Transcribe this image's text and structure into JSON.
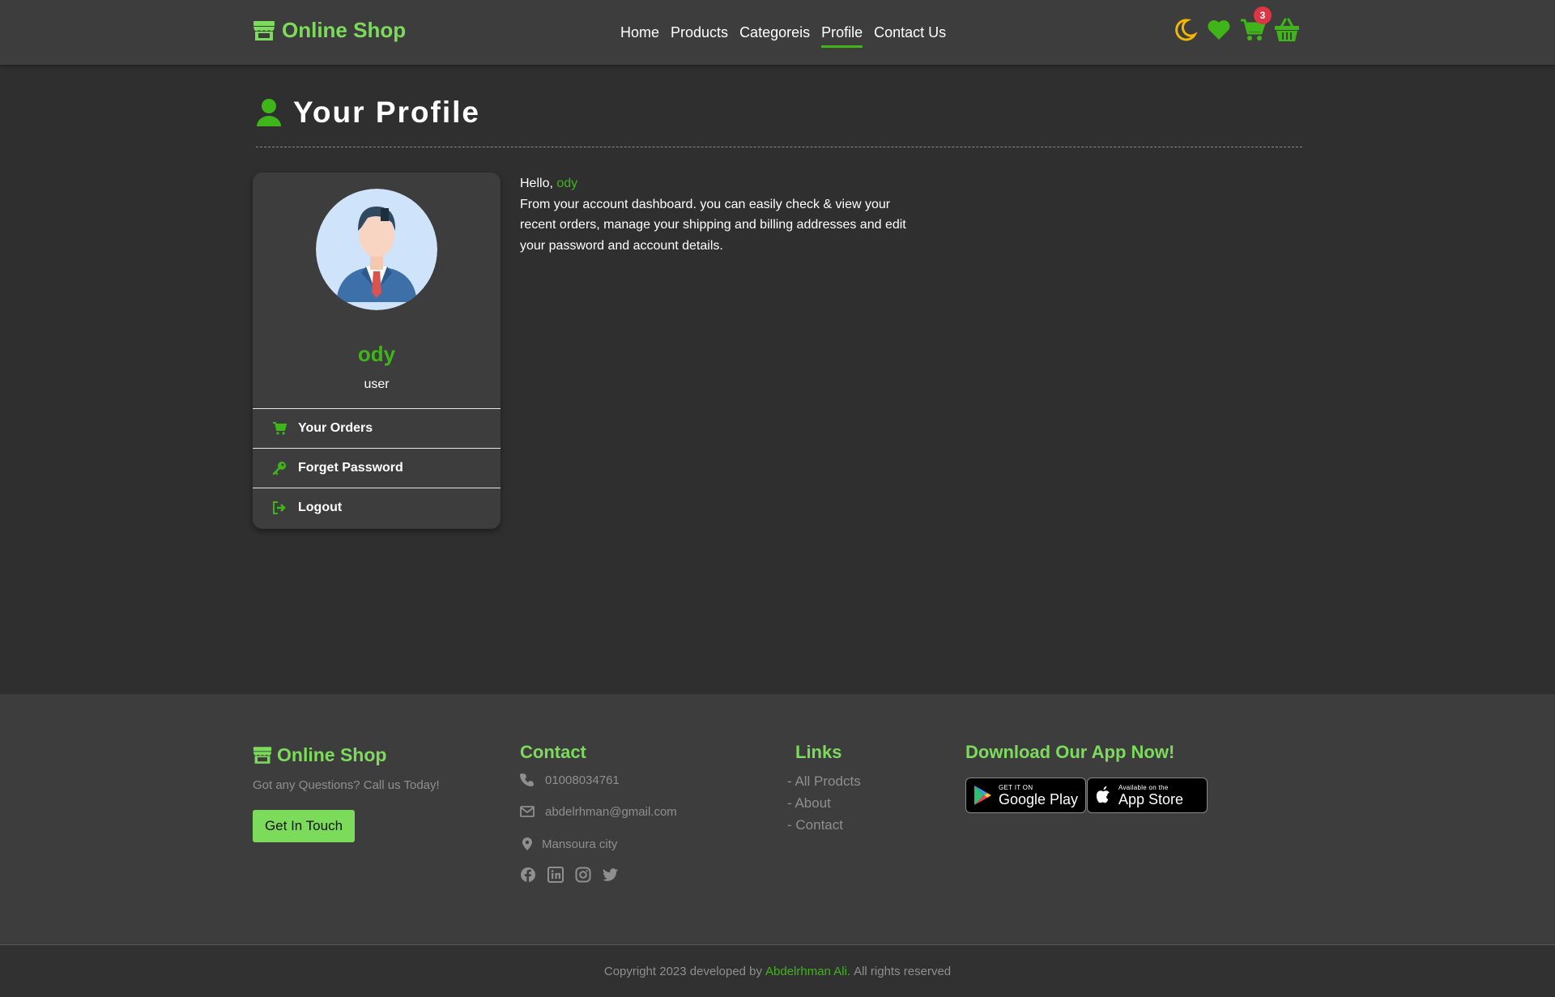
{
  "navbar": {
    "brand": "Online Shop",
    "links": [
      "Home",
      "Products",
      "Categoreis",
      "Profile",
      "Contact Us"
    ],
    "active_link": "Profile",
    "cart_count": "3",
    "icons": [
      "moon-icon",
      "heart-icon",
      "cart-icon",
      "basket-icon"
    ]
  },
  "page": {
    "title": "Your Profile"
  },
  "profile": {
    "name": "ody",
    "role": "user",
    "menu": [
      "Your Orders",
      "Forget Password",
      "Logout"
    ]
  },
  "greeting": {
    "hello": "Hello,",
    "username": "ody",
    "message": "From your account dashboard. you can easily check & view your recent orders, manage your shipping and billing addresses and edit your password and account details."
  },
  "footer": {
    "brand": "Online Shop",
    "tagline": "Got any Questions? Call us Today!",
    "cta": "Get In Touch",
    "contact_heading": "Contact",
    "phone": "01008034761",
    "email": "abdelrhman@gmail.com",
    "location": "Mansoura city",
    "socials": [
      "facebook-icon",
      "linkedin-icon",
      "instagram-icon",
      "twitter-icon"
    ],
    "links_heading": "Links",
    "links": [
      "- All Prodcts",
      "- About",
      "- Contact"
    ],
    "app_heading": "Download Our App Now!",
    "google_small": "GET IT ON",
    "google_big": "Google Play",
    "apple_small": "Available on the",
    "apple_big": "App Store",
    "copyright_prefix": "Copyright 2023 developed by",
    "copyright_author": "Abdelrhman Ali.",
    "copyright_suffix": "All rights reserved"
  },
  "colors": {
    "accent": "#3fb51a",
    "accent_light": "#7ddb5c",
    "moon": "#f2b705",
    "badge": "#dc3545"
  }
}
